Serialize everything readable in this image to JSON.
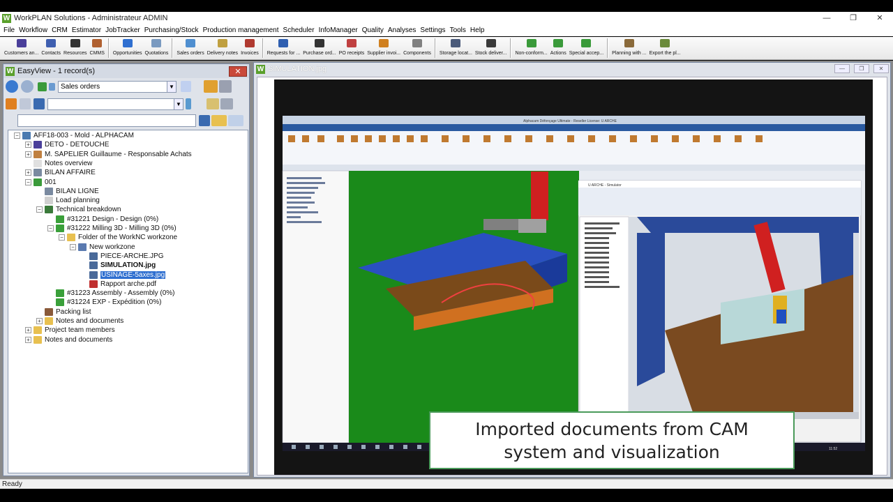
{
  "window": {
    "title": "WorkPLAN Solutions - Administrateur ADMIN",
    "logo_letter": "W",
    "controls": [
      "—",
      "❐",
      "✕"
    ]
  },
  "menu": [
    "File",
    "Workflow",
    "CRM",
    "Estimator",
    "JobTracker",
    "Purchasing/Stock",
    "Production management",
    "Scheduler",
    "InfoManager",
    "Quality",
    "Analyses",
    "Settings",
    "Tools",
    "Help"
  ],
  "toolbar": {
    "groups": [
      [
        {
          "label": "Customers an...",
          "color": "#4a3f9a"
        },
        {
          "label": "Contacts",
          "color": "#3f5fb0"
        },
        {
          "label": "Resources",
          "color": "#333333"
        },
        {
          "label": "CMMS",
          "color": "#b06030"
        }
      ],
      [
        {
          "label": "Opportunities",
          "color": "#2f6fd0"
        },
        {
          "label": "Quotations",
          "color": "#7a9ac0"
        }
      ],
      [
        {
          "label": "Sales orders",
          "color": "#4f8fd0"
        },
        {
          "label": "Delivery notes",
          "color": "#c0a040"
        },
        {
          "label": "Invoices",
          "color": "#b03a30"
        }
      ],
      [
        {
          "label": "Requests for ...",
          "color": "#2f5fb0"
        },
        {
          "label": "Purchase ord...",
          "color": "#333333"
        },
        {
          "label": "PO receipts",
          "color": "#c04040"
        },
        {
          "label": "Supplier invoi...",
          "color": "#d08020"
        },
        {
          "label": "Components",
          "color": "#808080"
        }
      ],
      [
        {
          "label": "Storage locat...",
          "color": "#4a5a7a"
        },
        {
          "label": "Stock deliver...",
          "color": "#3a3a3a"
        }
      ],
      [
        {
          "label": "Non-conform...",
          "color": "#3a9a3a"
        },
        {
          "label": "Actions",
          "color": "#3a9a3a"
        },
        {
          "label": "Special accep...",
          "color": "#3a9a3a"
        }
      ],
      [
        {
          "label": "Planning with ...",
          "color": "#8a6a3a"
        },
        {
          "label": "Export the pl...",
          "color": "#6a8a3a"
        }
      ]
    ]
  },
  "easyview": {
    "title": "EasyView - 1 record(s)",
    "close": "✕",
    "type_combo": "Sales orders",
    "filter_combo": "",
    "search": ""
  },
  "tree": [
    {
      "label": "AFF18-003 - Mold - ALPHACAM",
      "level": 0,
      "exp": "−",
      "icon": "#4a7ab0"
    },
    {
      "label": "DETO - DETOUCHE",
      "level": 1,
      "exp": "+",
      "icon": "#4a3f9a"
    },
    {
      "label": "M. SAPELIER Guillaume - Responsable Achats",
      "level": 1,
      "exp": "+",
      "icon": "#c08040"
    },
    {
      "label": "Notes overview",
      "level": 1,
      "exp": "",
      "icon": "#e0e0e0"
    },
    {
      "label": "BILAN AFFAIRE",
      "level": 1,
      "exp": "+",
      "icon": "#7a8aa0"
    },
    {
      "label": "001",
      "level": 1,
      "exp": "−",
      "icon": "#3a9a3a"
    },
    {
      "label": "BILAN LIGNE",
      "level": 2,
      "exp": "",
      "icon": "#7a8aa0"
    },
    {
      "label": "Load planning",
      "level": 2,
      "exp": "",
      "icon": "#d0d0d0"
    },
    {
      "label": "Technical breakdown",
      "level": 2,
      "exp": "−",
      "icon": "#3a7a3a"
    },
    {
      "label": "#31221 Design - Design (0%)",
      "level": 3,
      "exp": "",
      "icon": "#3aa03a"
    },
    {
      "label": "#31222 Milling 3D - Milling 3D (0%)",
      "level": 3,
      "exp": "−",
      "icon": "#3aa03a"
    },
    {
      "label": "Folder of the WorkNC workzone",
      "level": 4,
      "exp": "−",
      "icon": "#e8c050"
    },
    {
      "label": "New workzone",
      "level": 5,
      "exp": "−",
      "icon": "#5a7ab0"
    },
    {
      "label": "PIECE-ARCHE.JPG",
      "level": 6,
      "exp": "",
      "icon": "#4a6a9a"
    },
    {
      "label": "SIMULATION.jpg",
      "level": 6,
      "exp": "",
      "icon": "#4a6a9a",
      "bold": true
    },
    {
      "label": "USINAGE-5axes.jpg",
      "level": 6,
      "exp": "",
      "icon": "#4a6a9a",
      "selected": true
    },
    {
      "label": "Rapport arche.pdf",
      "level": 6,
      "exp": "",
      "icon": "#c03030"
    },
    {
      "label": "#31223 Assembly - Assembly (0%)",
      "level": 3,
      "exp": "",
      "icon": "#3aa03a"
    },
    {
      "label": "#31224 EXP - Expédition (0%)",
      "level": 3,
      "exp": "",
      "icon": "#3aa03a"
    },
    {
      "label": "Packing list",
      "level": 2,
      "exp": "",
      "icon": "#8a5a3a"
    },
    {
      "label": "Notes and documents",
      "level": 2,
      "exp": "+",
      "icon": "#e8c050"
    },
    {
      "label": "Project team members",
      "level": 1,
      "exp": "+",
      "icon": "#e8c050"
    },
    {
      "label": "Notes and documents",
      "level": 1,
      "exp": "+",
      "icon": "#e8c050"
    }
  ],
  "simulation": {
    "title": "SIMULATION.jpg",
    "controls": [
      "—",
      "❐",
      "✕"
    ]
  },
  "video": {
    "caption_line1": "Imported documents from CAM",
    "caption_line2": "system and visualization",
    "app_title": "Alphacam Défonçage Ultimate - Reseller License: U ARCHE",
    "sim_title": "U ARCHE - Simulator",
    "clock": "11:52"
  },
  "status": "Ready"
}
